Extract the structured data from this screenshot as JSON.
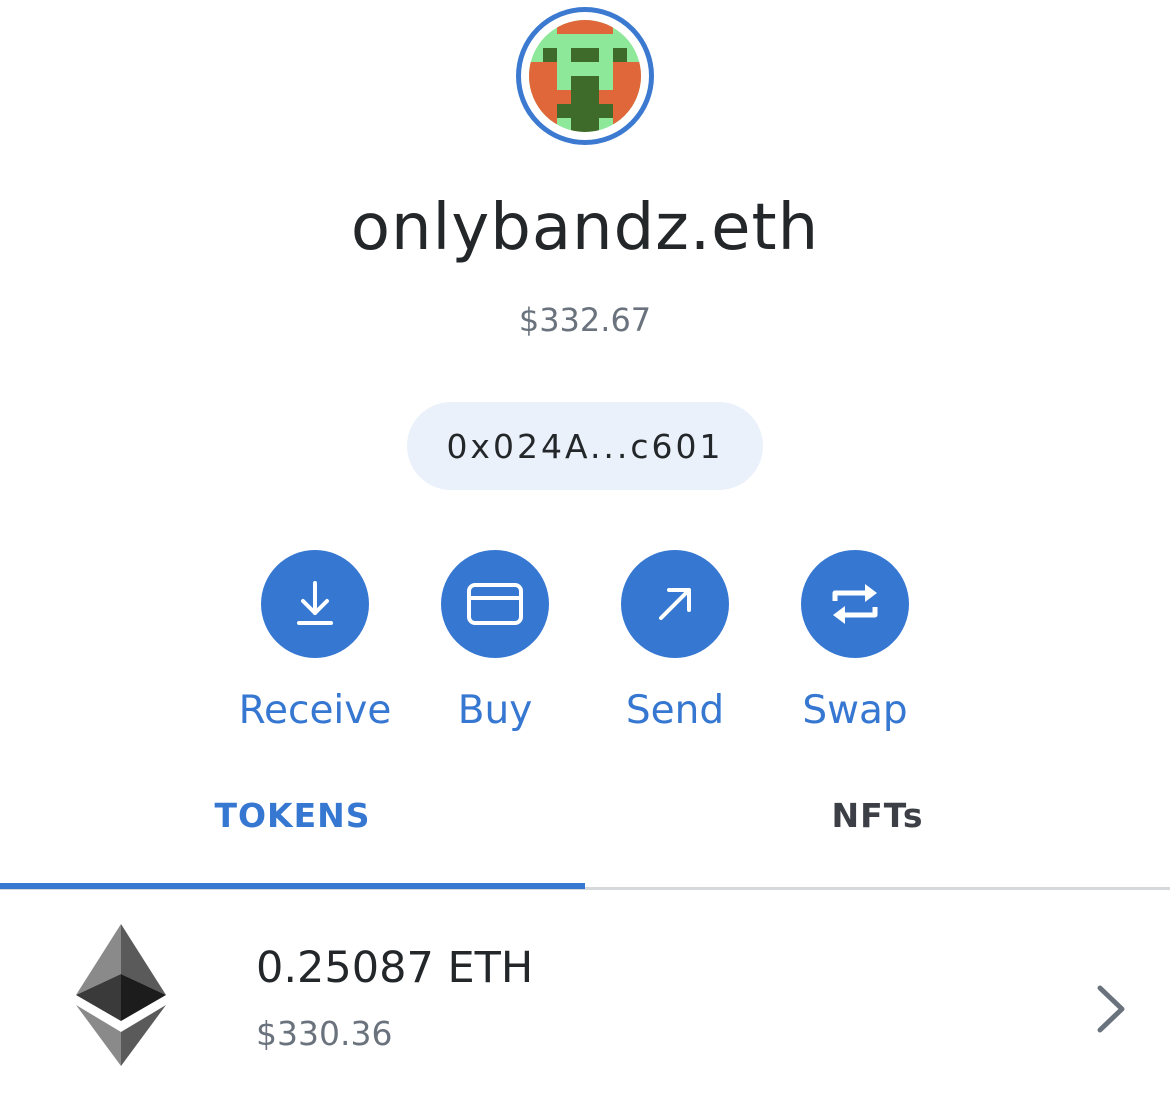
{
  "account": {
    "name": "onlybandz.eth",
    "balance": "$332.67",
    "address": "0x024A...c601"
  },
  "colors": {
    "accent": "#3577d1",
    "pill_background": "#eaf1fa",
    "avatar_green": "#8de89a",
    "avatar_orange": "#e0673a",
    "avatar_dark_green": "#3e6a2a"
  },
  "actions": [
    {
      "label": "Receive",
      "icon": "download-icon"
    },
    {
      "label": "Buy",
      "icon": "credit-card-icon"
    },
    {
      "label": "Send",
      "icon": "arrow-up-right-icon"
    },
    {
      "label": "Swap",
      "icon": "swap-arrows-icon"
    }
  ],
  "tabs": [
    {
      "label": "TOKENS",
      "active": true
    },
    {
      "label": "NFTs",
      "active": false
    }
  ],
  "tokens": [
    {
      "amount": "0.25087 ETH",
      "fiat": "$330.36",
      "icon": "ethereum-icon"
    }
  ]
}
